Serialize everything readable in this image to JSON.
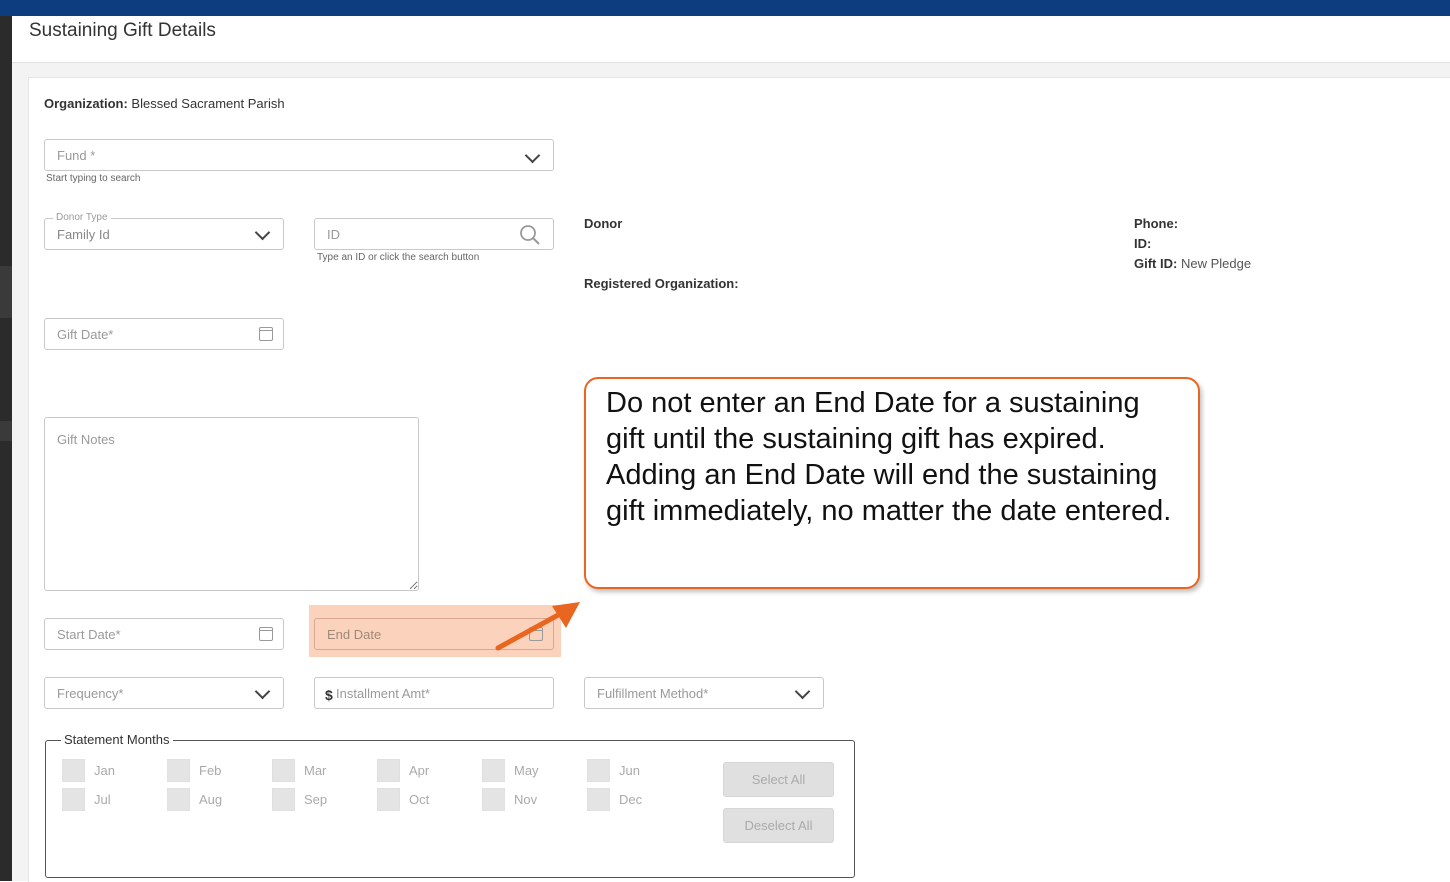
{
  "header": {
    "title": "Sustaining Gift Details"
  },
  "organization": {
    "label": "Organization:",
    "value": "Blessed Sacrament Parish"
  },
  "fund": {
    "placeholder": "Fund *",
    "hint": "Start typing to search"
  },
  "donor_type": {
    "legend": "Donor Type",
    "value": "Family Id"
  },
  "id_field": {
    "placeholder": "ID",
    "hint": "Type an ID or click the search button"
  },
  "donor_info": {
    "donor_label": "Donor",
    "registered_org_label": "Registered Organization:",
    "phone_label": "Phone:",
    "id_label": "ID:",
    "gift_id_label": "Gift ID:",
    "gift_id_value": "New Pledge"
  },
  "gift_date": {
    "placeholder": "Gift Date*"
  },
  "gift_notes": {
    "placeholder": "Gift Notes"
  },
  "start_date": {
    "placeholder": "Start Date*"
  },
  "end_date": {
    "placeholder": "End Date"
  },
  "frequency": {
    "placeholder": "Frequency*"
  },
  "installment": {
    "currency": "$",
    "placeholder": "Installment Amt*"
  },
  "fulfillment": {
    "placeholder": "Fulfillment Method*"
  },
  "statement_months": {
    "legend": "Statement Months",
    "row1": [
      "Jan",
      "Feb",
      "Mar",
      "Apr",
      "May",
      "Jun"
    ],
    "row2": [
      "Jul",
      "Aug",
      "Sep",
      "Oct",
      "Nov",
      "Dec"
    ],
    "select_all": "Select All",
    "deselect_all": "Deselect All"
  },
  "callout": {
    "text": "Do not enter an End Date for a sustaining gift until the sustaining gift has expired. Adding an End Date will end the sustaining gift immediately, no matter the date entered."
  },
  "colors": {
    "topbar": "#0d3d7e",
    "callout_border": "#e8661f",
    "highlight": "#fbd3bd"
  }
}
